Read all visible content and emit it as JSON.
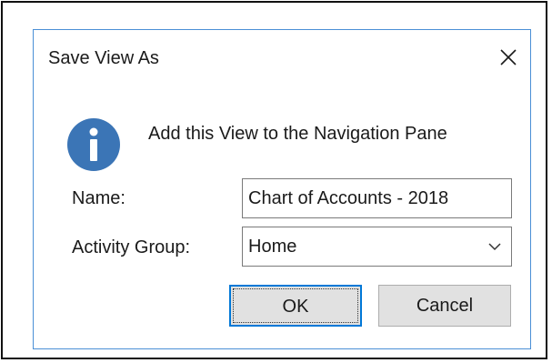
{
  "dialog": {
    "title": "Save View As",
    "close_icon": "close-icon",
    "info_icon": "info-icon",
    "message": "Add this View to the Navigation Pane",
    "name_label": "Name:",
    "name_value": "Chart of Accounts - 2018",
    "group_label": "Activity Group:",
    "group_value": "Home",
    "ok_label": "OK",
    "cancel_label": "Cancel"
  },
  "colors": {
    "accent": "#0078d7",
    "dialog_border": "#4a8fd6",
    "info_icon": "#3b75b6",
    "button_face": "#e1e1e1"
  }
}
